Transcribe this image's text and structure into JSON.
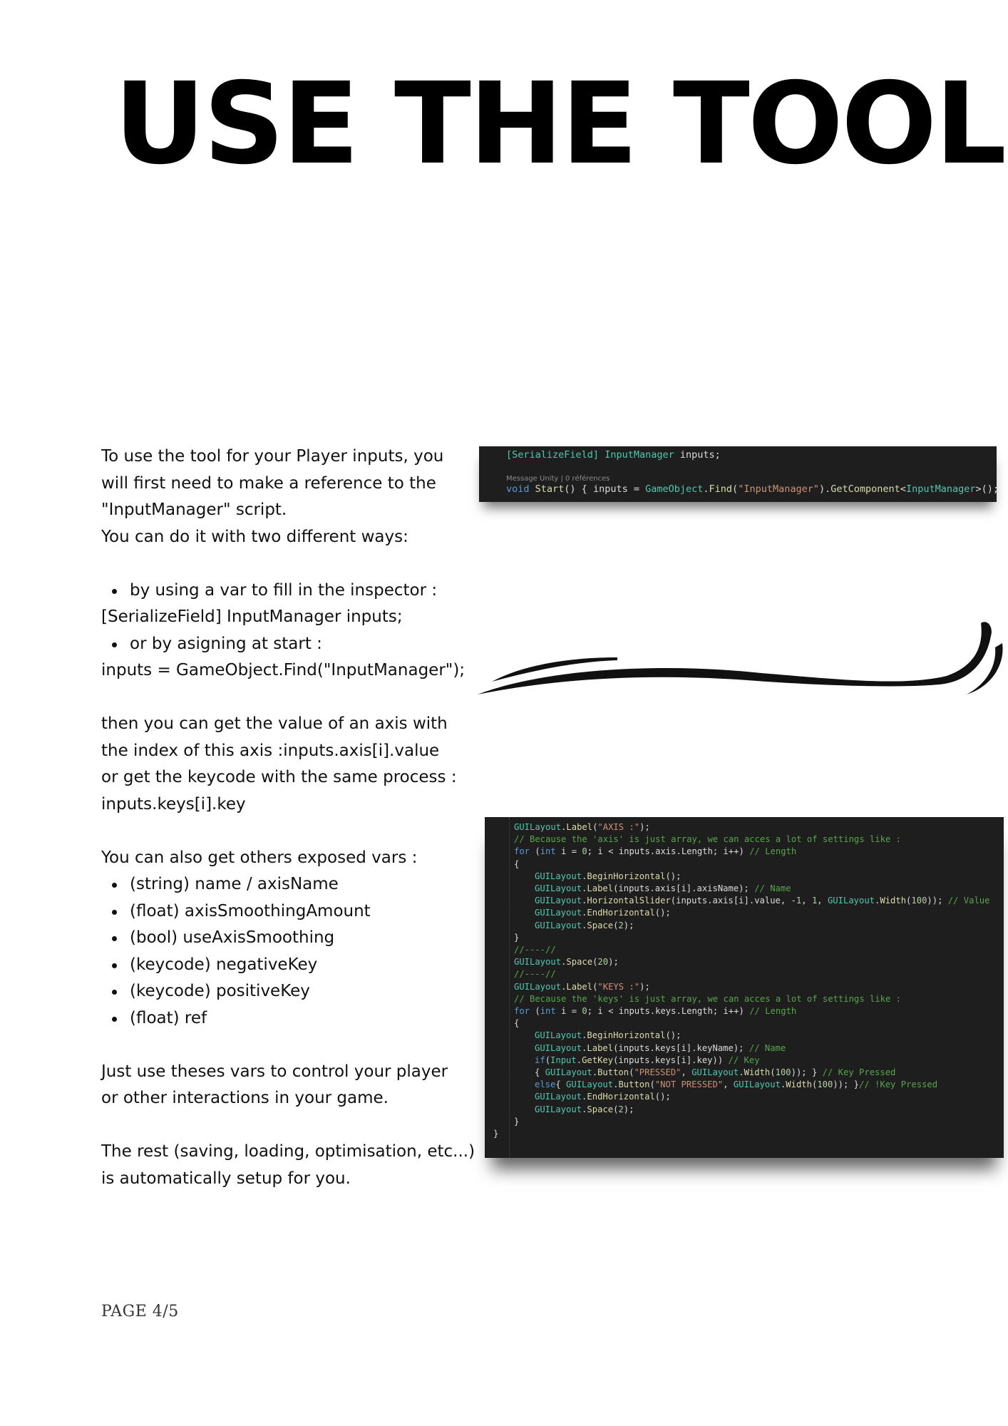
{
  "title": "USE THE TOOL",
  "body": {
    "intro": [
      "To use the tool for your Player inputs, you",
      "will first need to make a reference to the",
      "\"InputManager\" script.",
      "You can do it with two different ways:"
    ],
    "option1": "by using a var to fill in the inspector :",
    "option1_code": "[SerializeField] InputManager inputs;",
    "option2": "or by asigning at start :",
    "option2_code": "inputs = GameObject.Find(\"InputManager\");",
    "usage": [
      "then you can get the value of an axis with",
      "the index of this axis :inputs.axis[i].value",
      "or get the keycode with the same process :",
      "inputs.keys[i].key"
    ],
    "exposed_intro": "You can also get others exposed vars :",
    "exposed_vars": [
      "(string) name / axisName",
      "(float) axisSmoothingAmount",
      "(bool) useAxisSmoothing",
      "(keycode) negativeKey",
      "(keycode) positiveKey",
      "(float) ref"
    ],
    "control": [
      "Just use theses vars to control your player",
      "or other interactions in your game."
    ],
    "rest": [
      "The rest (saving, loading, optimisation, etc...)",
      "is automatically setup for you."
    ]
  },
  "code_snippet_1": {
    "line1": {
      "attr": "[SerializeField]",
      "type": "InputManager",
      "rest": " inputs;"
    },
    "hint": "Message Unity | 0 références",
    "line2": {
      "kw": "void",
      "fn": "Start",
      "open": "() { ",
      "var": "inputs",
      "eq": " = ",
      "cls": "GameObject",
      "dot": ".",
      "find": "Find",
      "p1": "(",
      "str": "\"InputManager\"",
      "p2": ").",
      "get": "GetComponent",
      "lt": "<",
      "gtype": "InputManager",
      "close": ">(); }"
    }
  },
  "code_snippet_2": {
    "lines": [
      "GUILayout.Label(\"AXIS :\");",
      "// Because the 'axis' is just array, we can acces a lot of settings like :",
      "for (int i = 0; i < inputs.axis.Length; i++) // Length",
      "{",
      "GUILayout.BeginHorizontal();",
      "GUILayout.Label(inputs.axis[i].axisName); // Name",
      "GUILayout.HorizontalSlider(inputs.axis[i].value, -1, 1, GUILayout.Width(100)); // Value",
      "GUILayout.EndHorizontal();",
      "GUILayout.Space(2);",
      "}",
      "//----//",
      "GUILayout.Space(20);",
      "//----//",
      "GUILayout.Label(\"KEYS :\");",
      "// Because the 'keys' is just array, we can acces a lot of settings like :",
      "for (int i = 0; i < inputs.keys.Length; i++) // Length",
      "{",
      "GUILayout.BeginHorizontal();",
      "GUILayout.Label(inputs.keys[i].keyName); // Name",
      "if(Input.GetKey(inputs.keys[i].key)) // Key",
      "{ GUILayout.Button(\"PRESSED\", GUILayout.Width(100)); } // Key Pressed",
      "else{ GUILayout.Button(\"NOT PRESSED\", GUILayout.Width(100)); }// !Key Pressed",
      "GUILayout.EndHorizontal();",
      "GUILayout.Space(2);",
      "}",
      "}"
    ]
  },
  "page_label": "PAGE 4/5"
}
